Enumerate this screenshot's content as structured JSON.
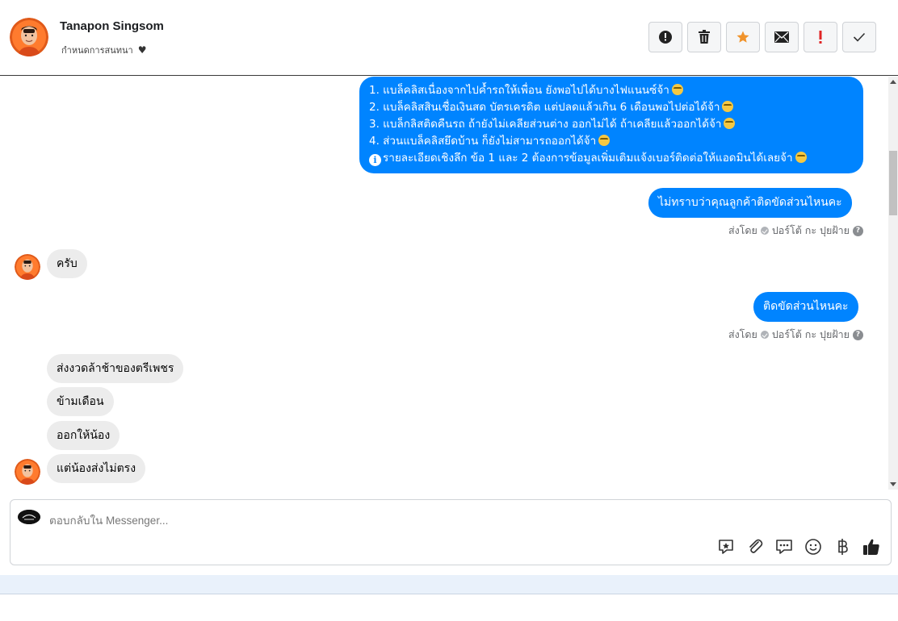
{
  "header": {
    "contact_name": "Tanapon Singsom",
    "assign_label": "กำหนดการสนทนา",
    "actions": [
      {
        "name": "report-spam",
        "icon": "alert-circle-icon"
      },
      {
        "name": "delete",
        "icon": "trash-icon"
      },
      {
        "name": "star",
        "icon": "star-icon",
        "color": "#f0932b"
      },
      {
        "name": "mark-unread",
        "icon": "envelope-icon"
      },
      {
        "name": "mark-important",
        "icon": "exclamation-icon",
        "color": "#e02424"
      },
      {
        "name": "mark-done",
        "icon": "check-icon"
      }
    ]
  },
  "conversation": {
    "long_message": {
      "lines": [
        "1. แบล็คลิสเนื่องจากไปค้ำรถให้เพื่อน ยังพอไปได้บางไฟแนนซ์จ้า",
        "2. แบล็คลิสสินเชื่อเงินสด บัตรเครดิต แต่ปลดแล้วเกิน 6 เดือนพอไปต่อได้จ้า",
        "3. แบล็กลิสติดคืนรถ ถ้ายังไม่เคลียส่วนต่าง ออกไม่ได้ ถ้าเคลียแล้วออกได้จ้า",
        "4. ส่วนแบล็คลิสยึดบ้าน ก็ยังไม่สามารถออกได้จ้า",
        "รายละเอียดเชิงลึก ข้อ 1 และ 2 ต้องการข้อมูลเพิ่มเติมแจ้งเบอร์ติดต่อให้แอดมินได้เลยจ้า"
      ]
    },
    "msg_ask": "ไม่ทราบว่าคุณลูกค้าติดขัดส่วนไหนคะ",
    "sent_by_1": {
      "prefix": "ส่งโดย",
      "agent": "ปอร์โต้ กะ ปุยฝ้าย",
      "help": "?"
    },
    "reply_krab": "ครับ",
    "msg_which_part": "ติดขัดส่วนไหนคะ",
    "sent_by_2": {
      "prefix": "ส่งโดย",
      "agent": "ปอร์โต้ กะ ปุยฝ้าย",
      "help": "?"
    },
    "reply_1": "ส่งงวดล้าช้าของตรีเพชร",
    "reply_2": "ข้ามเดือน",
    "reply_3": "ออกให้น้อง",
    "reply_4": "แต่น้องส่งไม่ตรง"
  },
  "composer": {
    "placeholder": "ตอบกลับใน Messenger...",
    "tools": [
      "sticker-icon",
      "attachment-icon",
      "saved-replies-icon",
      "emoji-icon",
      "baht-payment-icon",
      "thumbs-up-icon"
    ]
  },
  "colors": {
    "outgoing_bubble": "#0084ff",
    "incoming_bubble": "#ececec"
  }
}
